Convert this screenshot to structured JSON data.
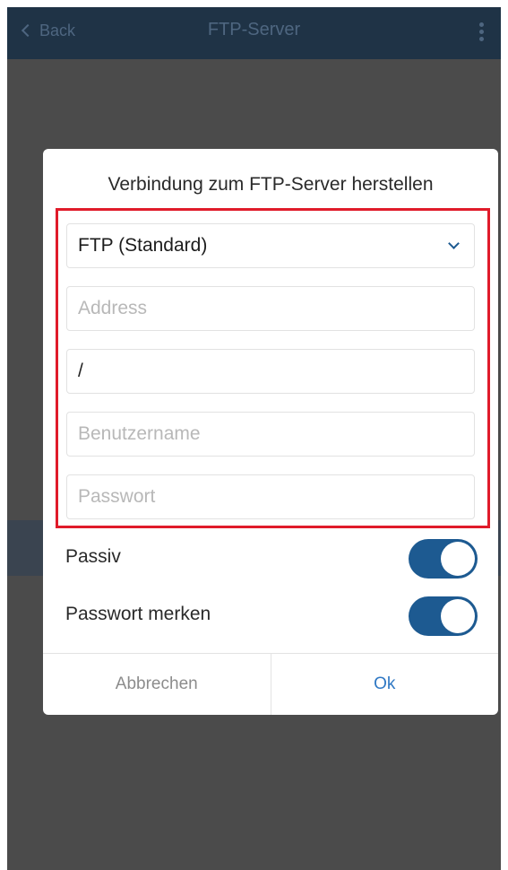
{
  "topbar": {
    "back_label": "Back",
    "title": "FTP-Server"
  },
  "dialog": {
    "title": "Verbindung zum FTP-Server herstellen",
    "protocol_select": {
      "value": "FTP (Standard)"
    },
    "address": {
      "placeholder": "Address",
      "value": ""
    },
    "path": {
      "value": "/"
    },
    "username": {
      "placeholder": "Benutzername",
      "value": ""
    },
    "password": {
      "placeholder": "Passwort",
      "value": ""
    },
    "passive": {
      "label": "Passiv",
      "on": true
    },
    "remember_password": {
      "label": "Passwort merken",
      "on": true
    },
    "cancel_label": "Abbrechen",
    "ok_label": "Ok"
  },
  "colors": {
    "accent": "#1d5a91",
    "highlight": "#e01b2a",
    "ok_text": "#2f78c4",
    "topbar": "#1f3346",
    "overlay": "#4b4b4b"
  }
}
